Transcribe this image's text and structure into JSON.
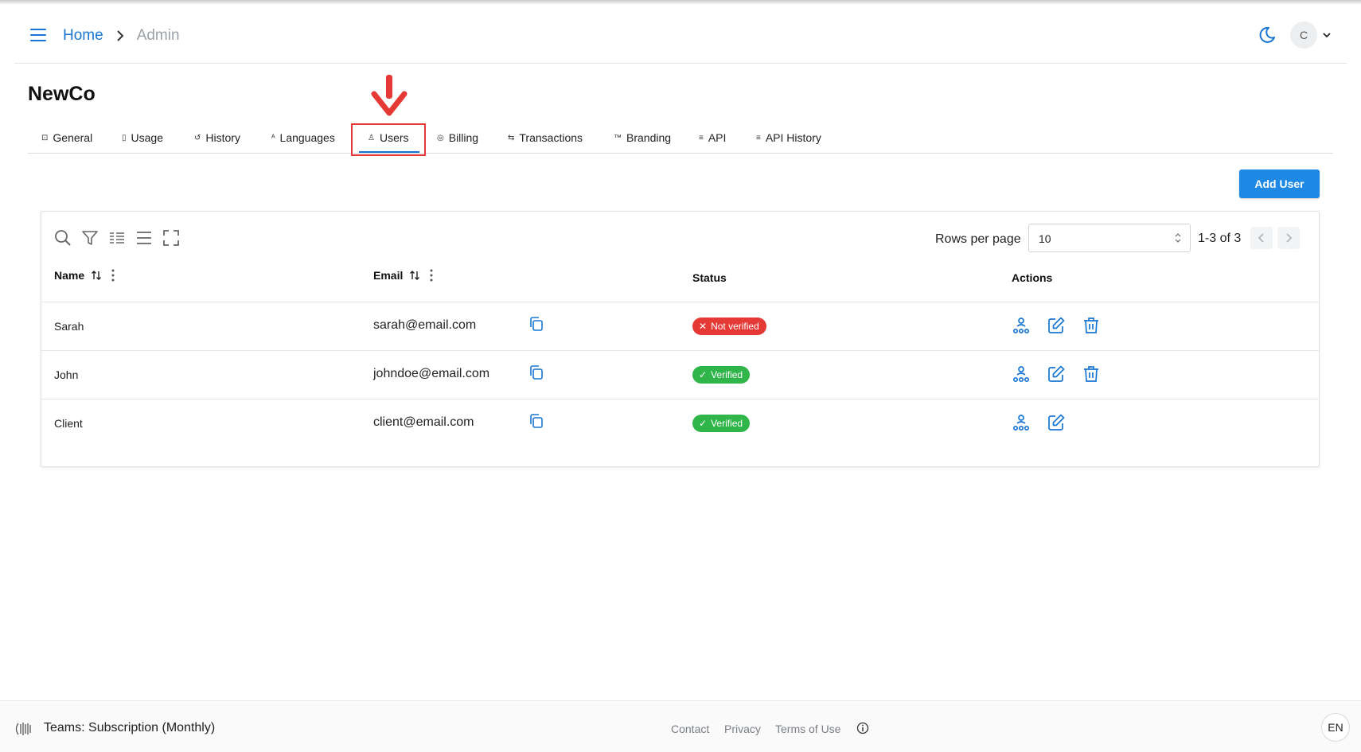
{
  "header": {
    "breadcrumb": {
      "home": "Home",
      "current": "Admin"
    },
    "avatar_initial": "C"
  },
  "page": {
    "title": "NewCo"
  },
  "tabs": [
    {
      "label": "General",
      "icon": "general-icon"
    },
    {
      "label": "Usage",
      "icon": "usage-icon"
    },
    {
      "label": "History",
      "icon": "history-icon"
    },
    {
      "label": "Languages",
      "icon": "languages-icon"
    },
    {
      "label": "Users",
      "icon": "user-icon",
      "active": true
    },
    {
      "label": "Billing",
      "icon": "billing-icon"
    },
    {
      "label": "Transactions",
      "icon": "transactions-icon"
    },
    {
      "label": "Branding",
      "icon": "branding-icon"
    },
    {
      "label": "API",
      "icon": "api-icon"
    },
    {
      "label": "API History",
      "icon": "api-history-icon"
    }
  ],
  "actions": {
    "add_user": "Add User"
  },
  "table": {
    "rows_per_page_label": "Rows per page",
    "rows_per_page_value": "10",
    "page_info": "1-3 of 3",
    "columns": [
      "Name",
      "Email",
      "Status",
      "Actions"
    ],
    "rows": [
      {
        "name": "Sarah",
        "email": "sarah@email.com",
        "status": "Not verified",
        "status_type": "error",
        "can_delete": true
      },
      {
        "name": "John",
        "email": "johndoe@email.com",
        "status": "Verified",
        "status_type": "success",
        "can_delete": true
      },
      {
        "name": "Client",
        "email": "client@email.com",
        "status": "Verified",
        "status_type": "success",
        "can_delete": false
      }
    ]
  },
  "footer": {
    "plan": "Teams: Subscription (Monthly)",
    "links": [
      "Contact",
      "Privacy",
      "Terms of Use"
    ],
    "language": "EN"
  },
  "colors": {
    "accent": "#1976d2",
    "button": "#1e88e5",
    "error": "#e53935",
    "success": "#2fb54a",
    "annotation": "#e53935"
  }
}
